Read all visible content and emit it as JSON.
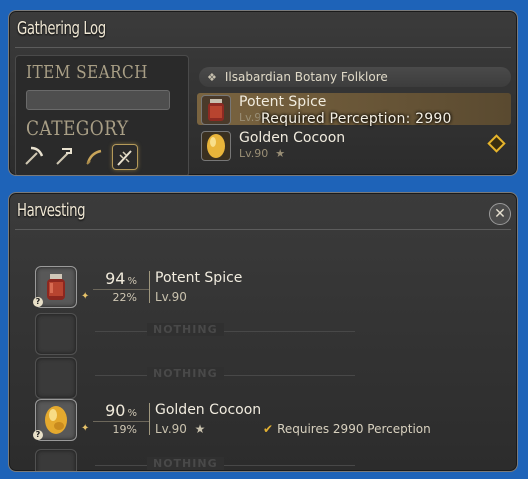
{
  "gathering_log": {
    "title": "Gathering Log",
    "item_search_label": "ITEM SEARCH",
    "search_value": "",
    "category_label": "CATEGORY",
    "category_icons": [
      "pickaxe-icon",
      "hammer-icon",
      "sickle-icon",
      "harvest-icon"
    ],
    "folklore_label": "Ilsabardian Botany Folklore",
    "items": [
      {
        "name": "Potent Spice",
        "level": "Lv.90",
        "icon": "potent-spice-icon"
      },
      {
        "name": "Golden Cocoon",
        "level": "Lv.90",
        "star": "★",
        "icon": "golden-cocoon-icon"
      }
    ],
    "tooltip": "Required Perception: 2990"
  },
  "harvesting": {
    "title": "Harvesting",
    "nothing_label": "NOTHING",
    "percent_unit": "%",
    "rows": [
      {
        "type": "item",
        "name": "Potent Spice",
        "level": "Lv.90",
        "chance": "94",
        "hq_chance": "22%",
        "star": "",
        "requirement": ""
      },
      {
        "type": "empty"
      },
      {
        "type": "empty"
      },
      {
        "type": "item",
        "name": "Golden Cocoon",
        "level": "Lv.90",
        "chance": "90",
        "hq_chance": "19%",
        "star": "★",
        "requirement": "Requires 2990 Perception"
      },
      {
        "type": "empty"
      }
    ]
  },
  "colors": {
    "background": "#1e63b8",
    "panel": "#333333",
    "accent": "#e2b032"
  }
}
